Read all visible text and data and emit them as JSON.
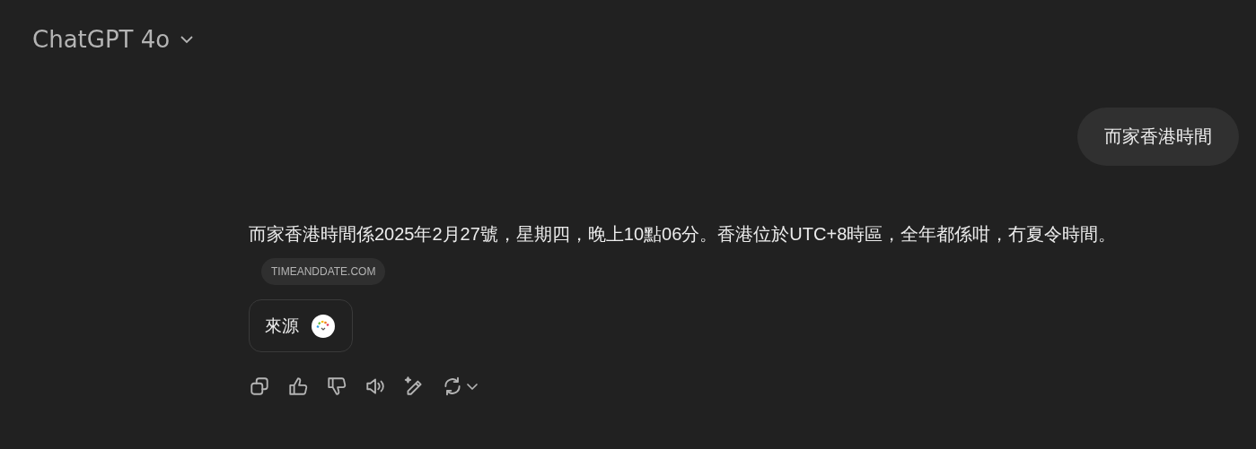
{
  "header": {
    "model": "ChatGPT 4o"
  },
  "user_message": {
    "text": "而家香港時間"
  },
  "assistant_message": {
    "text": "而家香港時間係2025年2月27號，星期四，晚上10點06分。香港位於UTC+8時區，全年都係咁，冇夏令時間。",
    "citation": "TIMEANDDATE.COM",
    "sources_label": "來源"
  }
}
